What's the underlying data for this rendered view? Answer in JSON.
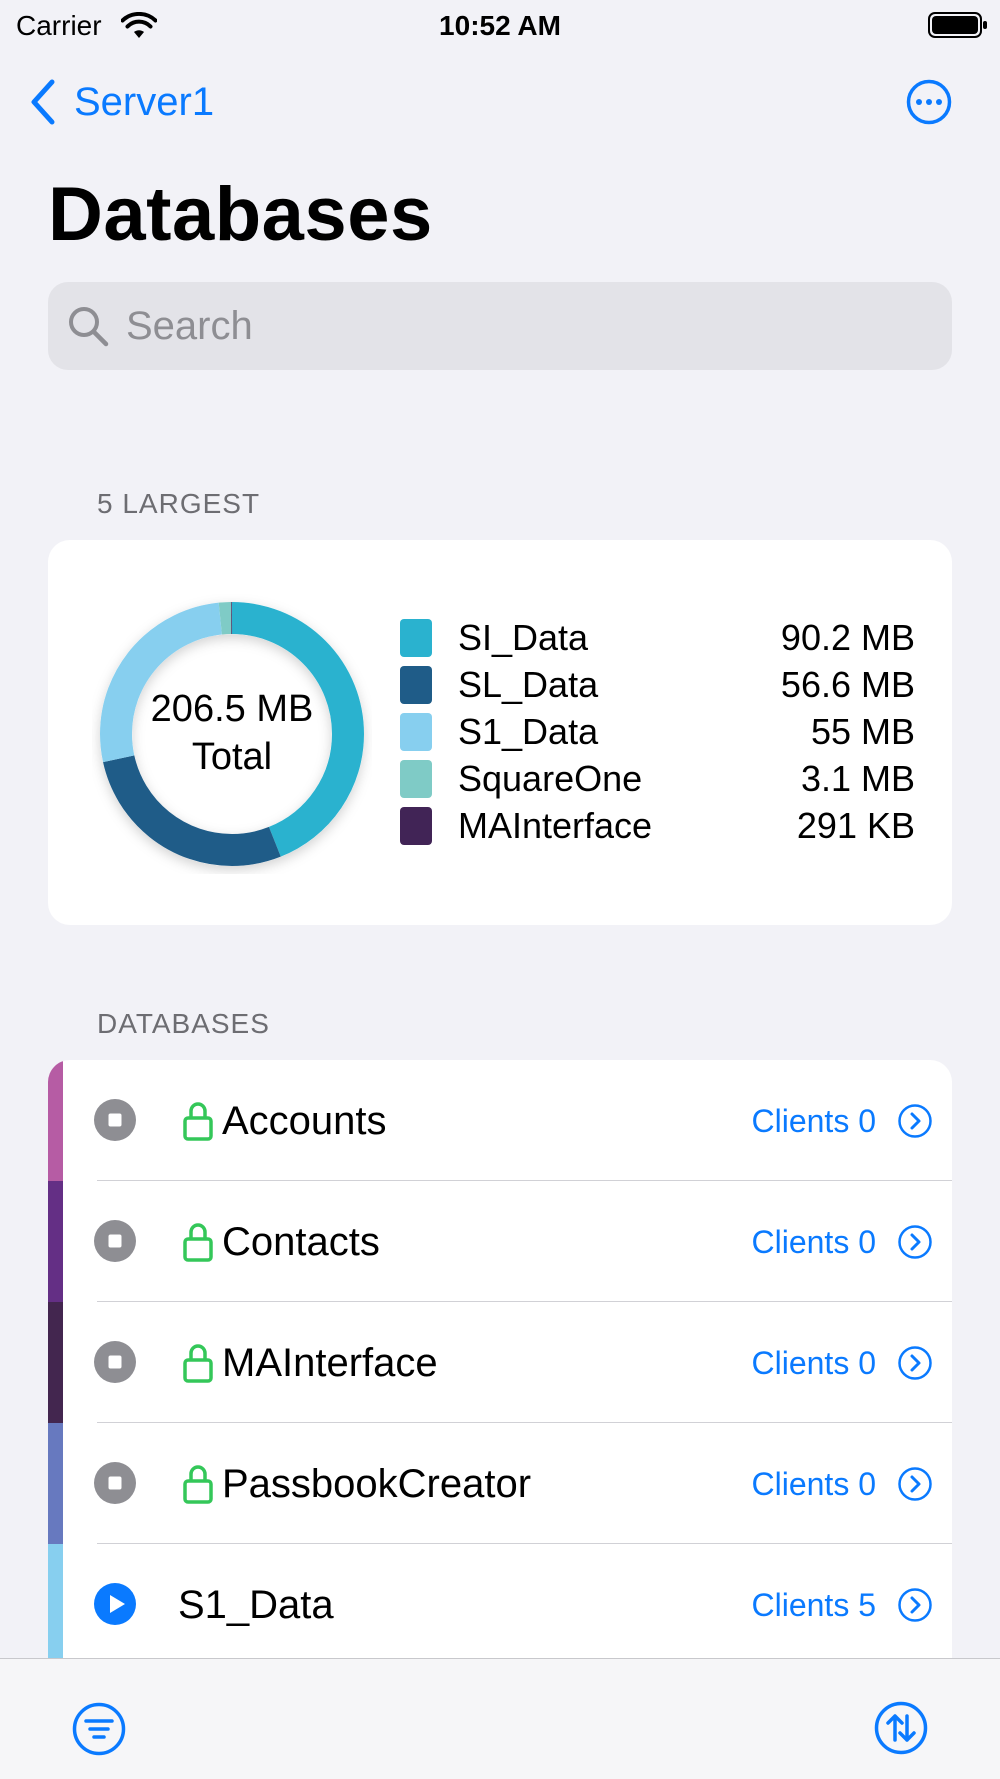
{
  "status_bar": {
    "carrier": "Carrier",
    "time": "10:52 AM"
  },
  "nav": {
    "back_label": "Server1",
    "more_icon": "ellipsis-circle-icon"
  },
  "page_title": "Databases",
  "search": {
    "placeholder": "Search"
  },
  "sections": {
    "largest_header": "5 LARGEST",
    "databases_header": "DATABASES"
  },
  "colors": {
    "accent": "#0a7aff",
    "lock_green": "#34c759",
    "stopped_gray": "#8e8e93"
  },
  "chart_data": {
    "type": "pie",
    "total_value": "206.5 MB",
    "total_word": "Total",
    "series": [
      {
        "name": "SI_Data",
        "value": 90.2,
        "size_label": "90.2 MB",
        "color": "#2ab2cf"
      },
      {
        "name": "SL_Data",
        "value": 56.6,
        "size_label": "56.6 MB",
        "color": "#1f5c88"
      },
      {
        "name": "S1_Data",
        "value": 55,
        "size_label": "55 MB",
        "color": "#87cfef"
      },
      {
        "name": "SquareOne",
        "value": 3.1,
        "size_label": "3.1 MB",
        "color": "#7fcbc6"
      },
      {
        "name": "MAInterface",
        "value": 0.291,
        "size_label": "291 KB",
        "color": "#412456"
      }
    ]
  },
  "databases": [
    {
      "name": "Accounts",
      "clients": "Clients 0",
      "status": "stopped",
      "locked": true,
      "strip_color": "#b65ca4"
    },
    {
      "name": "Contacts",
      "clients": "Clients 0",
      "status": "stopped",
      "locked": true,
      "strip_color": "#642f85"
    },
    {
      "name": "MAInterface",
      "clients": "Clients 0",
      "status": "stopped",
      "locked": true,
      "strip_color": "#43264f"
    },
    {
      "name": "PassbookCreator",
      "clients": "Clients 0",
      "status": "stopped",
      "locked": true,
      "strip_color": "#6779bf"
    },
    {
      "name": "S1_Data",
      "clients": "Clients 5",
      "status": "running",
      "locked": false,
      "strip_color": "#87cfef"
    }
  ],
  "toolbar": {
    "filter_icon": "filter-icon",
    "sort_icon": "sort-icon"
  }
}
